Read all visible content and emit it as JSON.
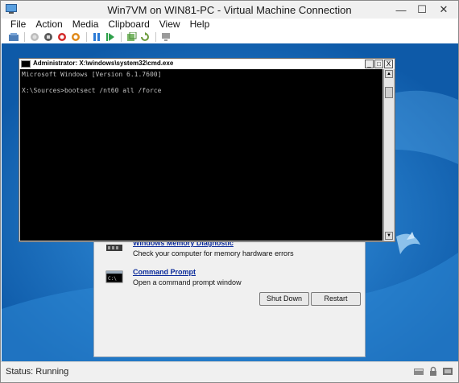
{
  "window": {
    "title": "Win7VM on WIN81-PC - Virtual Machine Connection",
    "minimize_glyph": "—",
    "maximize_glyph": "☐",
    "close_glyph": "✕"
  },
  "menu": {
    "items": [
      "File",
      "Action",
      "Media",
      "Clipboard",
      "View",
      "Help"
    ]
  },
  "toolbar": {
    "buttons": [
      "ctrl-alt-del-icon",
      "start-icon",
      "turn-off-icon",
      "shut-down-icon",
      "save-icon",
      "pause-icon",
      "resume-icon",
      "checkpoint-icon",
      "revert-icon",
      "enhanced-session-icon"
    ]
  },
  "cmd": {
    "title": "Administrator: X:\\windows\\system32\\cmd.exe",
    "lines": [
      "Microsoft Windows [Version 6.1.7600]",
      "",
      "X:\\Sources>bootsect /nt60 all /force"
    ],
    "min_glyph": "_",
    "max_glyph": "□",
    "close_glyph": "X",
    "scroll_up_glyph": "▲",
    "scroll_down_glyph": "▼"
  },
  "recovery": {
    "items": [
      {
        "link": "Windows Memory Diagnostic",
        "desc": "Check your computer for memory hardware errors"
      },
      {
        "link": "Command Prompt",
        "desc": "Open a command prompt window"
      }
    ],
    "shutdown_label": "Shut Down",
    "restart_label": "Restart"
  },
  "status": {
    "text": "Status: Running"
  },
  "colors": {
    "desktop": "#1a73c4",
    "link": "#0a2a9a"
  }
}
